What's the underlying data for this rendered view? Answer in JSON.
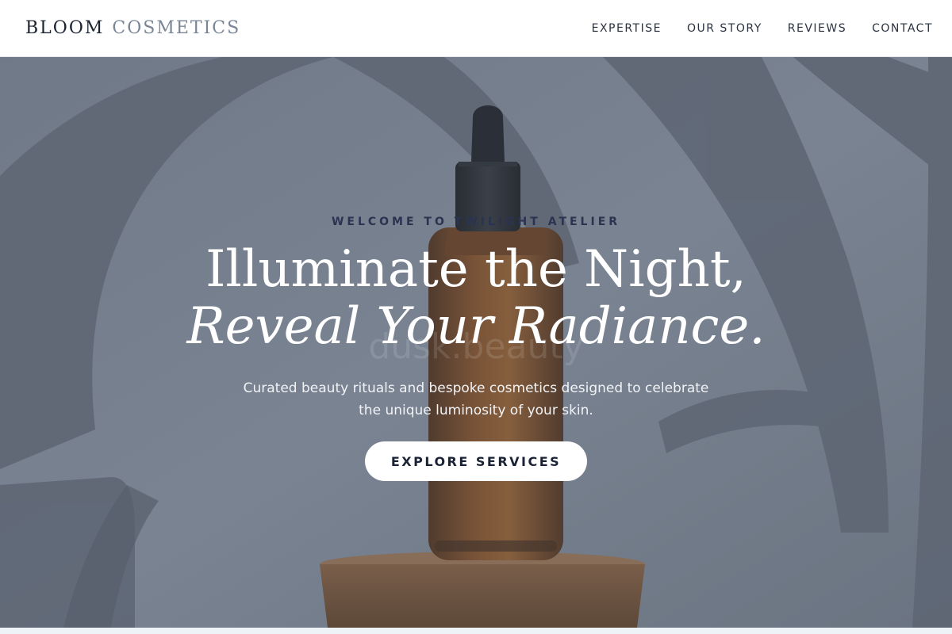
{
  "header": {
    "logo_word1": "BLOOM",
    "logo_word2": "COSMETICS",
    "nav": [
      "EXPERTISE",
      "OUR STORY",
      "REVIEWS",
      "CONTACT"
    ]
  },
  "hero": {
    "eyebrow": "WELCOME TO TWILIGHT ATELIER",
    "headline_line1": "Illuminate the Night,",
    "headline_line2": "Reveal Your Radiance.",
    "bottle_label": "dusk.beauty",
    "subtitle": "Curated beauty rituals and bespoke cosmetics designed to celebrate the unique luminosity of your skin.",
    "cta_label": "EXPLORE SERVICES"
  },
  "colors": {
    "header_bg": "#ffffff",
    "logo_dark": "#1c2331",
    "logo_light": "#7a8696",
    "hero_overlay": "#5c6676",
    "bottle_amber": "#7a3f12",
    "cta_bg": "#ffffff",
    "cta_text": "#1a2236"
  }
}
